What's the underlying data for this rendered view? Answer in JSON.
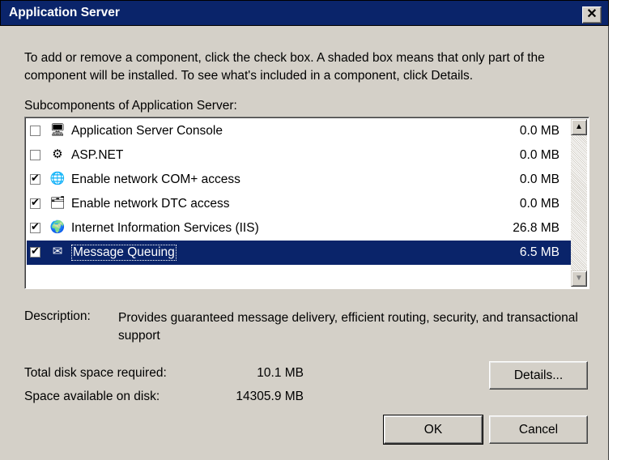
{
  "window": {
    "title": "Application Server",
    "close_glyph": "✕"
  },
  "intro_text": "To add or remove a component, click the check box. A shaded box means that only part of the component will be installed. To see what's included in a component, click Details.",
  "subcomponents_label": "Subcomponents of Application Server:",
  "components": [
    {
      "label": "Application Server Console",
      "size": "0.0 MB",
      "checked": false,
      "icon": "console-icon",
      "glyph": "🖥"
    },
    {
      "label": "ASP.NET",
      "size": "0.0 MB",
      "checked": false,
      "icon": "gears-icon",
      "glyph": "⚙"
    },
    {
      "label": "Enable network COM+ access",
      "size": "0.0 MB",
      "checked": true,
      "icon": "com-icon",
      "glyph": "🌐"
    },
    {
      "label": "Enable network DTC access",
      "size": "0.0 MB",
      "checked": true,
      "icon": "dtc-icon",
      "glyph": "🗂"
    },
    {
      "label": "Internet Information Services (IIS)",
      "size": "26.8 MB",
      "checked": true,
      "icon": "iis-icon",
      "glyph": "🌍"
    },
    {
      "label": "Message Queuing",
      "size": "6.5 MB",
      "checked": true,
      "icon": "envelope-icon",
      "glyph": "✉",
      "selected": true
    }
  ],
  "description": {
    "label": "Description:",
    "text": "Provides guaranteed message delivery, efficient routing, security, and transactional support"
  },
  "disk": {
    "required_label": "Total disk space required:",
    "required_value": "10.1 MB",
    "available_label": "Space available on disk:",
    "available_value": "14305.9 MB"
  },
  "buttons": {
    "details": "Details...",
    "ok": "OK",
    "cancel": "Cancel"
  },
  "colors": {
    "selection": "#0a246a",
    "dialog_bg": "#d4d0c8"
  }
}
